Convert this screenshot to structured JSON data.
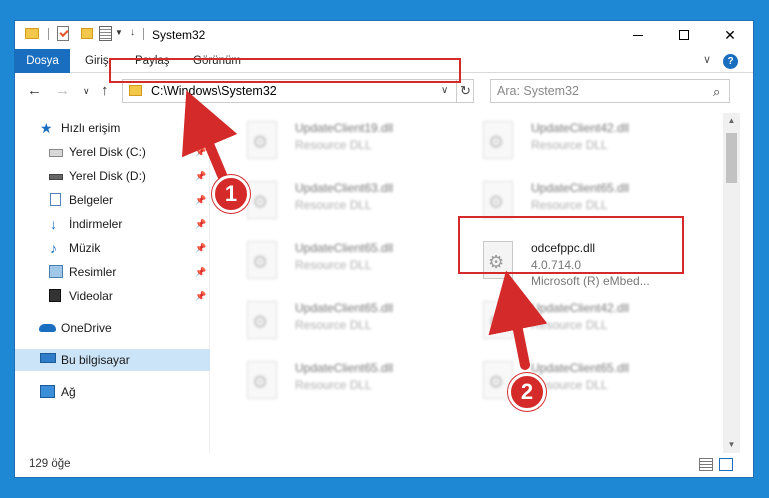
{
  "window": {
    "title": "System32",
    "quick_access_down": "↓"
  },
  "ribbon": {
    "tabs": [
      "Dosya",
      "Giriş",
      "Paylaş",
      "Görünüm"
    ],
    "expand": "∨",
    "help": "?"
  },
  "nav": {
    "back": "←",
    "forward": "→",
    "recent": "∨",
    "up": "↑",
    "address": "C:\\Windows\\System32",
    "address_drop": "∨",
    "refresh": "↻",
    "search_placeholder": "Ara: System32"
  },
  "sidebar": {
    "items": [
      {
        "label": "Hızlı erişim",
        "icon": "star-icon",
        "pinned": false
      },
      {
        "label": "Yerel Disk (C:)",
        "icon": "disk-icon",
        "pinned": true
      },
      {
        "label": "Yerel Disk (D:)",
        "icon": "disk-icon",
        "pinned": true
      },
      {
        "label": "Belgeler",
        "icon": "document-icon",
        "pinned": true
      },
      {
        "label": "İndirmeler",
        "icon": "download-icon",
        "pinned": true
      },
      {
        "label": "Müzik",
        "icon": "music-icon",
        "pinned": true
      },
      {
        "label": "Resimler",
        "icon": "picture-icon",
        "pinned": true
      },
      {
        "label": "Videolar",
        "icon": "video-icon",
        "pinned": true
      },
      {
        "label": "OneDrive",
        "icon": "cloud-icon",
        "pinned": false
      },
      {
        "label": "Bu bilgisayar",
        "icon": "computer-icon",
        "pinned": false,
        "selected": true
      },
      {
        "label": "Ağ",
        "icon": "network-icon",
        "pinned": false
      }
    ]
  },
  "files": [
    {
      "name": "UpdateClient19.dll",
      "desc": "Resource DLL"
    },
    {
      "name": "UpdateClient42.dll",
      "desc": "Resource DLL"
    },
    {
      "name": "UpdateClient63.dll",
      "desc": "Resource DLL"
    },
    {
      "name": "UpdateClient65.dll",
      "desc": "Resource DLL"
    },
    {
      "name": "UpdateClient65.dll",
      "desc": "Resource DLL"
    },
    {
      "name": "odcefppc.dll",
      "desc": "4.0.714.0",
      "desc2": "Microsoft (R) eMbed...",
      "highlight": true
    },
    {
      "name": "UpdateClient65.dll",
      "desc": "Resource DLL"
    },
    {
      "name": "UpdateClient42.dll",
      "desc": "Resource DLL"
    },
    {
      "name": "UpdateClient65.dll",
      "desc": "Resource DLL"
    },
    {
      "name": "UpdateClient65.dll",
      "desc": "Resource DLL"
    }
  ],
  "status": {
    "item_count": "129 öğe"
  },
  "annotations": {
    "step1": "1",
    "step2": "2",
    "color": "#d42a2a"
  },
  "colors": {
    "accent": "#1a6ebf",
    "selection": "#cce4f7",
    "desktop": "#1e88d4"
  }
}
